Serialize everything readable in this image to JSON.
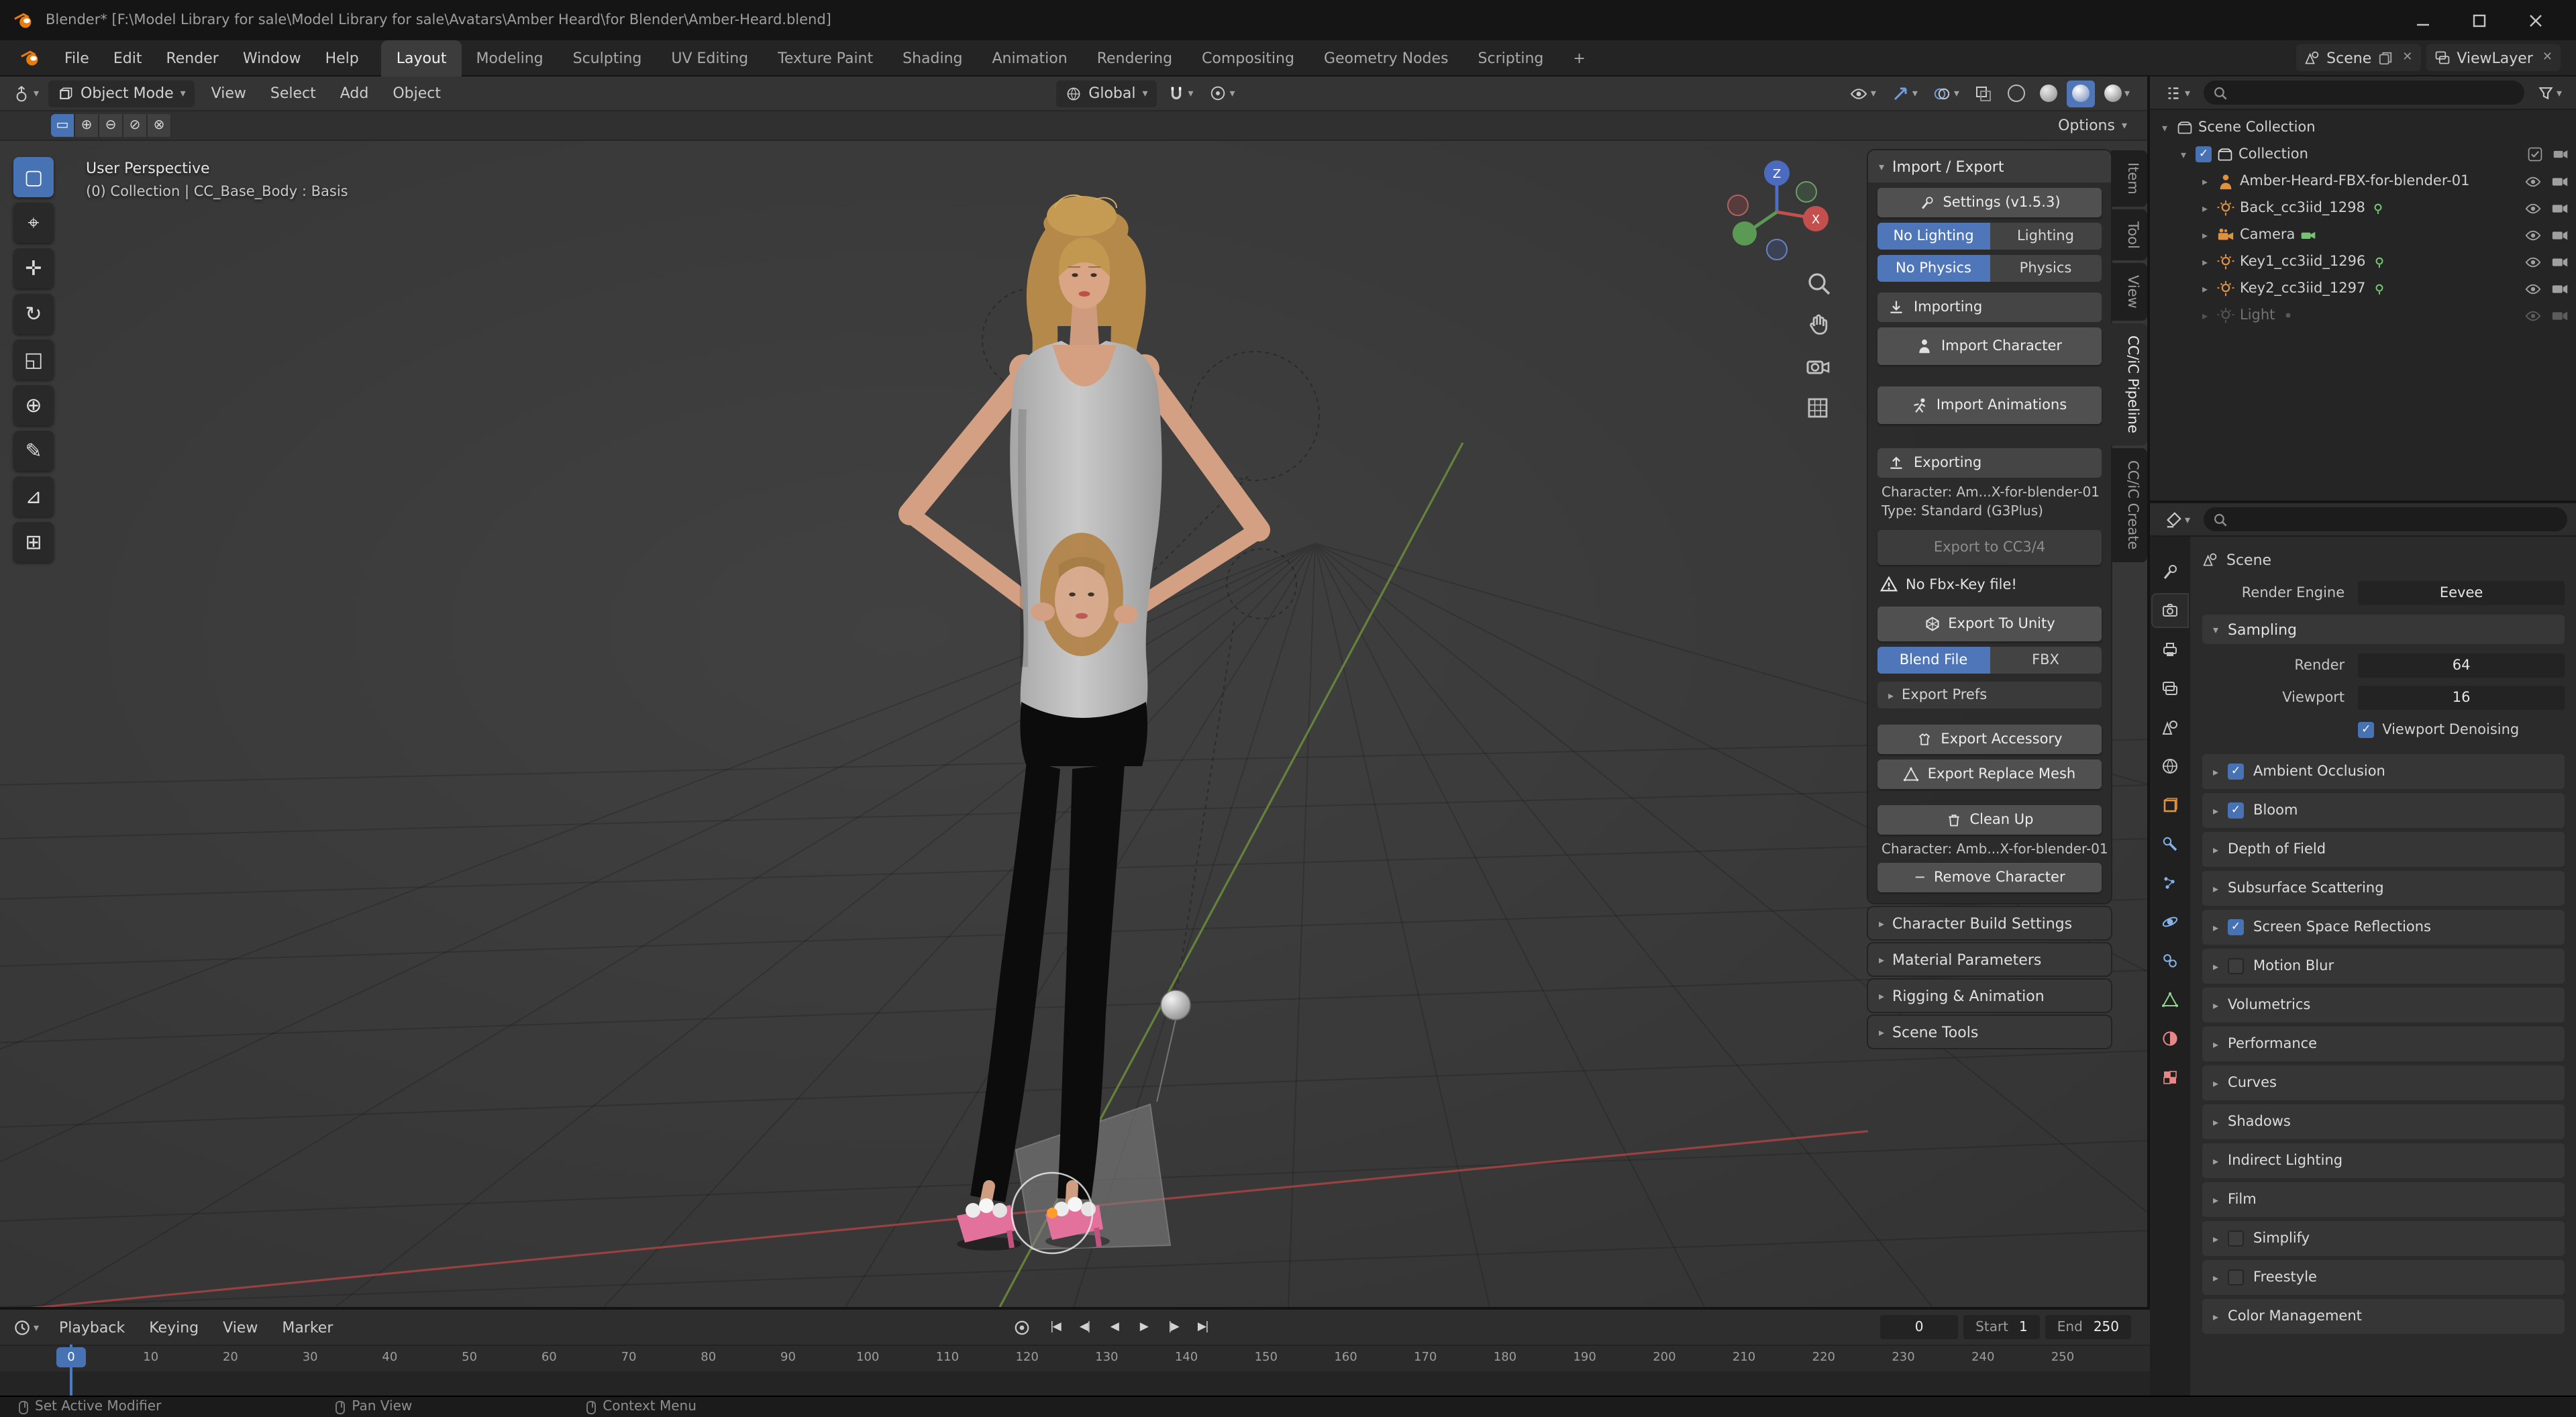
{
  "window": {
    "title": "Blender* [F:\\Model Library for sale\\Model Library for sale\\Avatars\\Amber Heard\\for Blender\\Amber-Heard.blend]"
  },
  "accent": {
    "blue": "#4772b3",
    "orange": "#e87d0d",
    "warning_row": "#3c3c3c"
  },
  "topbar": {
    "menus": [
      "File",
      "Edit",
      "Render",
      "Window",
      "Help"
    ],
    "workspaces": [
      "Layout",
      "Modeling",
      "Sculpting",
      "UV Editing",
      "Texture Paint",
      "Shading",
      "Animation",
      "Rendering",
      "Compositing",
      "Geometry Nodes",
      "Scripting"
    ],
    "active_workspace": "Layout",
    "add_tab": "+",
    "scene_name": "Scene",
    "view_layer_name": "ViewLayer"
  },
  "viewport": {
    "mode": "Object Mode",
    "menus": [
      "View",
      "Select",
      "Add",
      "Object"
    ],
    "orientation": "Global",
    "select_modes": [
      "set",
      "extend",
      "subtract",
      "invert",
      "intersect"
    ],
    "options_label": "Options",
    "overlay_line1": "User Perspective",
    "overlay_line2": "(0) Collection | CC_Base_Body : Basis",
    "gizmo": {
      "z": "Z",
      "x": "X"
    },
    "nav_icons": [
      "zoom",
      "pan-hand",
      "camera-view",
      "toggle-orthographic"
    ],
    "toolbar": [
      "select-box",
      "cursor",
      "move",
      "rotate",
      "scale",
      "transform",
      "annotate",
      "measure",
      "add-cube"
    ],
    "active_tool": "select-box",
    "shading_modes": [
      "wireframe",
      "solid",
      "material-preview",
      "rendered"
    ],
    "active_shading": "material-preview"
  },
  "npanel": {
    "tabs": [
      "Item",
      "Tool",
      "View",
      "CC/iC Pipeline",
      "CC/iC Create"
    ],
    "active_tab": "CC/iC Pipeline",
    "header": "Import / Export",
    "settings_button": "Settings  (v1.5.3)",
    "lighting_toggle": {
      "options": [
        "No Lighting",
        "Lighting"
      ],
      "selected": "No Lighting"
    },
    "physics_toggle": {
      "options": [
        "No Physics",
        "Physics"
      ],
      "selected": "No Physics"
    },
    "importing_label": "Importing",
    "import_character": "Import Character",
    "import_animations": "Import Animations",
    "exporting_label": "Exporting",
    "character_line": "Character: Am...X-for-blender-01",
    "type_line": "Type: Standard (G3Plus)",
    "export_cc34": "Export to CC3/4",
    "warning": "No Fbx-Key file!",
    "export_unity": "Export To Unity",
    "format_toggle": {
      "options": [
        "Blend File",
        "FBX"
      ],
      "selected": "Blend File"
    },
    "export_prefs": "Export Prefs",
    "export_accessory": "Export Accessory",
    "export_replace_mesh": "Export Replace Mesh",
    "clean_up": "Clean Up",
    "character_line2": "Character: Amb...X-for-blender-01",
    "remove_character": "Remove Character",
    "sections": [
      "Character Build Settings",
      "Material Parameters",
      "Rigging & Animation",
      "Scene Tools"
    ]
  },
  "outliner": {
    "root": "Scene Collection",
    "collection": {
      "name": "Collection",
      "checked": true
    },
    "items": [
      {
        "name": "Amber-Heard-FBX-for-blender-01",
        "icon": "armature-person",
        "data_icon": "",
        "dimmed": false
      },
      {
        "name": "Back_cc3iid_1298",
        "icon": "light",
        "data_icon": "light-data",
        "dimmed": false
      },
      {
        "name": "Camera",
        "icon": "camera",
        "data_icon": "camera-data",
        "dimmed": false
      },
      {
        "name": "Key1_cc3iid_1296",
        "icon": "light",
        "data_icon": "light-data",
        "dimmed": false
      },
      {
        "name": "Key2_cc3iid_1297",
        "icon": "light",
        "data_icon": "light-data",
        "dimmed": false
      },
      {
        "name": "Light",
        "icon": "light",
        "data_icon": "dot",
        "dimmed": true
      }
    ]
  },
  "properties": {
    "tabs": [
      "tool",
      "render",
      "output",
      "view-layer",
      "scene",
      "world",
      "object",
      "modifiers",
      "particles",
      "physics",
      "constraints",
      "object-data",
      "material",
      "texture"
    ],
    "active_tab": "render",
    "breadcrumb": "Scene",
    "render_engine_label": "Render Engine",
    "render_engine_value": "Eevee",
    "sampling": {
      "title": "Sampling",
      "rows": [
        {
          "label": "Render",
          "value": "64"
        },
        {
          "label": "Viewport",
          "value": "16"
        }
      ],
      "checkbox": "Viewport Denoising",
      "checkbox_checked": true
    },
    "sections": [
      {
        "label": "Ambient Occlusion",
        "checkbox": true,
        "checked": true
      },
      {
        "label": "Bloom",
        "checkbox": true,
        "checked": true
      },
      {
        "label": "Depth of Field",
        "checkbox": false,
        "checked": false
      },
      {
        "label": "Subsurface Scattering",
        "checkbox": false,
        "checked": false
      },
      {
        "label": "Screen Space Reflections",
        "checkbox": true,
        "checked": true
      },
      {
        "label": "Motion Blur",
        "checkbox": true,
        "checked": false
      },
      {
        "label": "Volumetrics",
        "checkbox": false,
        "checked": false
      },
      {
        "label": "Performance",
        "checkbox": false,
        "checked": false
      },
      {
        "label": "Curves",
        "checkbox": false,
        "checked": false
      },
      {
        "label": "Shadows",
        "checkbox": false,
        "checked": false
      },
      {
        "label": "Indirect Lighting",
        "checkbox": false,
        "checked": false
      },
      {
        "label": "Film",
        "checkbox": false,
        "checked": false
      },
      {
        "label": "Simplify",
        "checkbox": true,
        "checked": false
      },
      {
        "label": "Freestyle",
        "checkbox": true,
        "checked": false
      },
      {
        "label": "Color Management",
        "checkbox": false,
        "checked": false
      }
    ]
  },
  "timeline": {
    "menus": [
      "Playback",
      "Keying",
      "View",
      "Marker"
    ],
    "transport": [
      "jump-to-start",
      "jump-to-prev-keyframe",
      "play-reverse",
      "play",
      "jump-to-next-keyframe",
      "jump-to-end"
    ],
    "current_frame": "0",
    "start_label": "Start",
    "start_value": "1",
    "end_label": "End",
    "end_value": "250",
    "playhead_label": "0",
    "ticks": [
      "0",
      "10",
      "20",
      "30",
      "40",
      "50",
      "60",
      "70",
      "80",
      "90",
      "100",
      "110",
      "120",
      "130",
      "140",
      "150",
      "160",
      "170",
      "180",
      "190",
      "200",
      "210",
      "220",
      "230",
      "240",
      "250"
    ]
  },
  "statusbar": {
    "hints": [
      "Set Active Modifier",
      "Pan View",
      "Context Menu"
    ]
  }
}
